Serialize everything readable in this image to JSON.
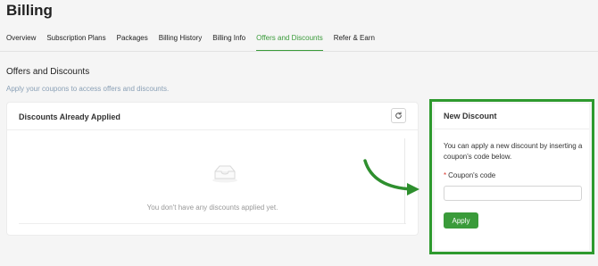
{
  "page": {
    "title": "Billing"
  },
  "tabs": [
    {
      "label": "Overview"
    },
    {
      "label": "Subscription Plans"
    },
    {
      "label": "Packages"
    },
    {
      "label": "Billing History"
    },
    {
      "label": "Billing Info"
    },
    {
      "label": "Offers and Discounts",
      "active": true
    },
    {
      "label": "Refer & Earn"
    }
  ],
  "section": {
    "title": "Offers and Discounts",
    "subtitle": "Apply your coupons to access offers and discounts."
  },
  "applied": {
    "title": "Discounts Already Applied",
    "empty_text": "You don't have any discounts applied yet.",
    "refresh_icon": "refresh-icon"
  },
  "new_discount": {
    "title": "New Discount",
    "description": "You can apply a new discount by inserting a coupon's code below.",
    "required_mark": "*",
    "field_label": "Coupon's code",
    "coupon_value": "",
    "apply_label": "Apply"
  },
  "colors": {
    "accent": "#3a9b3a",
    "highlight": "#2e9a2e",
    "subtitle": "#8aa0b6"
  }
}
